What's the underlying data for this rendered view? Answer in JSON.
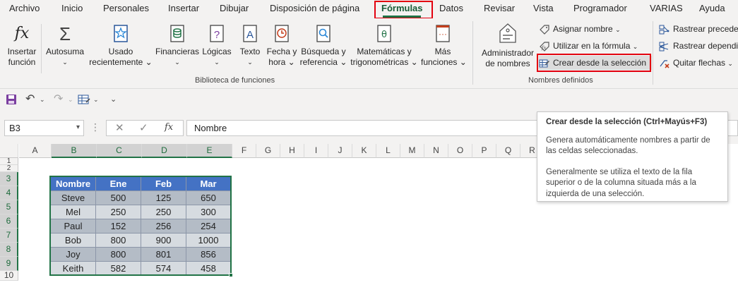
{
  "tabs": [
    "Archivo",
    "Inicio",
    "Personales",
    "Insertar",
    "Dibujar",
    "Disposición de página",
    "Fórmulas",
    "Datos",
    "Revisar",
    "Vista",
    "Programador",
    "VARIAS",
    "Ayuda"
  ],
  "active_tab": "Fórmulas",
  "ribbon": {
    "insert_function": [
      "Insertar",
      "función"
    ],
    "autosum": "Autosuma",
    "recent": [
      "Usado",
      "recientemente"
    ],
    "financial": "Financieras",
    "logical": "Lógicas",
    "text": "Texto",
    "datetime": [
      "Fecha y",
      "hora"
    ],
    "lookup": [
      "Búsqueda y",
      "referencia"
    ],
    "math": [
      "Matemáticas y",
      "trigonométricas"
    ],
    "more": [
      "Más",
      "funciones"
    ],
    "group_library": "Biblioteca de funciones",
    "name_manager": [
      "Administrador",
      "de nombres"
    ],
    "define_name": "Asignar nombre",
    "use_in_formula": "Utilizar en la fórmula",
    "create_from_selection": "Crear desde la selección",
    "group_names": "Nombres definidos",
    "trace_precedents": "Rastrear preceder",
    "trace_dependents": "Rastrear dependie",
    "remove_arrows": "Quitar flechas"
  },
  "formula_bar": {
    "name_box": "B3",
    "formula": "Nombre",
    "fx_label": "fx"
  },
  "columns": [
    "A",
    "B",
    "C",
    "D",
    "E",
    "F",
    "G",
    "H",
    "I",
    "J",
    "K",
    "L",
    "M",
    "N",
    "O",
    "P",
    "Q",
    "R"
  ],
  "rows": [
    "1",
    "2",
    "3",
    "4",
    "5",
    "6",
    "7",
    "8",
    "9",
    "10"
  ],
  "table": {
    "headers": [
      "Nombre",
      "Ene",
      "Feb",
      "Mar"
    ],
    "rows": [
      [
        "Steve",
        "500",
        "125",
        "650"
      ],
      [
        "Mel",
        "250",
        "250",
        "300"
      ],
      [
        "Paul",
        "152",
        "256",
        "254"
      ],
      [
        "Bob",
        "800",
        "900",
        "1000"
      ],
      [
        "Joy",
        "800",
        "801",
        "856"
      ],
      [
        "Keith",
        "582",
        "574",
        "458"
      ]
    ]
  },
  "tooltip": {
    "title": "Crear desde la selección (Ctrl+Mayús+F3)",
    "p1": "Genera automáticamente nombres a partir de las celdas seleccionadas.",
    "p2": "Generalmente se utiliza el texto de la fila superior o de la columna situada más a la izquierda de una selección."
  },
  "colors": {
    "accent": "#217346",
    "highlight": "#e3000f",
    "table_header": "#4472c4"
  }
}
